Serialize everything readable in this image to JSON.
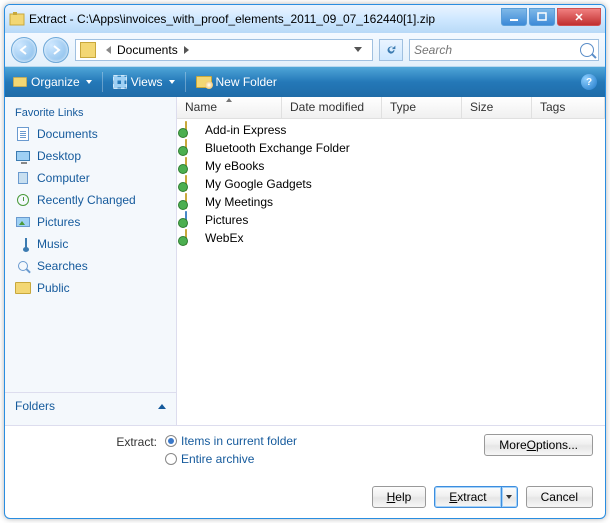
{
  "title": "Extract - C:\\Apps\\invoices_with_proof_elements_2011_09_07_162440[1].zip",
  "addressbar": {
    "location": "Documents"
  },
  "search": {
    "placeholder": "Search"
  },
  "toolbar": {
    "organize": "Organize",
    "views": "Views",
    "new_folder": "New Folder"
  },
  "sidebar": {
    "heading": "Favorite Links",
    "items": [
      {
        "label": "Documents"
      },
      {
        "label": "Desktop"
      },
      {
        "label": "Computer"
      },
      {
        "label": "Recently Changed"
      },
      {
        "label": "Pictures"
      },
      {
        "label": "Music"
      },
      {
        "label": "Searches"
      },
      {
        "label": "Public"
      }
    ],
    "folders_label": "Folders"
  },
  "columns": {
    "name": "Name",
    "date": "Date modified",
    "type": "Type",
    "size": "Size",
    "tags": "Tags"
  },
  "files": [
    {
      "name": "Add-in Express",
      "icon": "green"
    },
    {
      "name": "Bluetooth Exchange Folder",
      "icon": "green"
    },
    {
      "name": "My eBooks",
      "icon": "green"
    },
    {
      "name": "My Google Gadgets",
      "icon": "green"
    },
    {
      "name": "My Meetings",
      "icon": "green"
    },
    {
      "name": "Pictures",
      "icon": "blue"
    },
    {
      "name": "WebEx",
      "icon": "green"
    }
  ],
  "extract": {
    "label": "Extract:",
    "opt_current": "Items in current folder",
    "opt_entire": "Entire archive",
    "more_options": {
      "pre": "More ",
      "u": "O",
      "post": "ptions..."
    }
  },
  "buttons": {
    "help": {
      "u": "H",
      "post": "elp"
    },
    "extract": {
      "u": "E",
      "post": "xtract"
    },
    "cancel": "Cancel"
  }
}
